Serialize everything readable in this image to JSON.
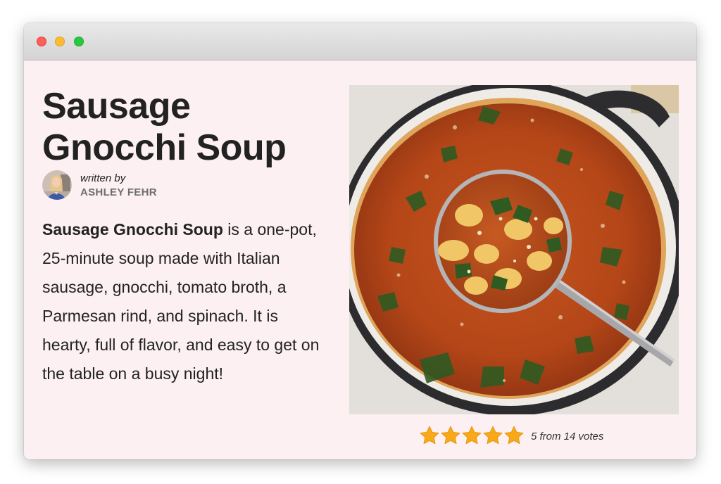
{
  "window": {
    "controls": [
      "close",
      "minimize",
      "zoom"
    ]
  },
  "recipe": {
    "title": "Sausage Gnocchi Soup",
    "author": {
      "written_by_label": "written by",
      "name": "ASHLEY FEHR",
      "avatar_icon": "author-avatar"
    },
    "description": {
      "bold_lead": "Sausage Gnocchi Soup",
      "text": " is a one-pot, 25-minute soup made with Italian sausage, gnocchi, tomato broth, a Parmesan rind, and spinach. It is hearty, full of flavor, and easy to get on the table on a busy night!"
    },
    "photo": {
      "subject": "pot of soup with ladle"
    },
    "rating": {
      "value": 5,
      "max": 5,
      "text": "5 from 14 votes",
      "star_color": "#f7a91a"
    }
  },
  "colors": {
    "page_background": "#fcf0f3",
    "title_text": "#222222",
    "author_name": "#6e6e6e"
  }
}
